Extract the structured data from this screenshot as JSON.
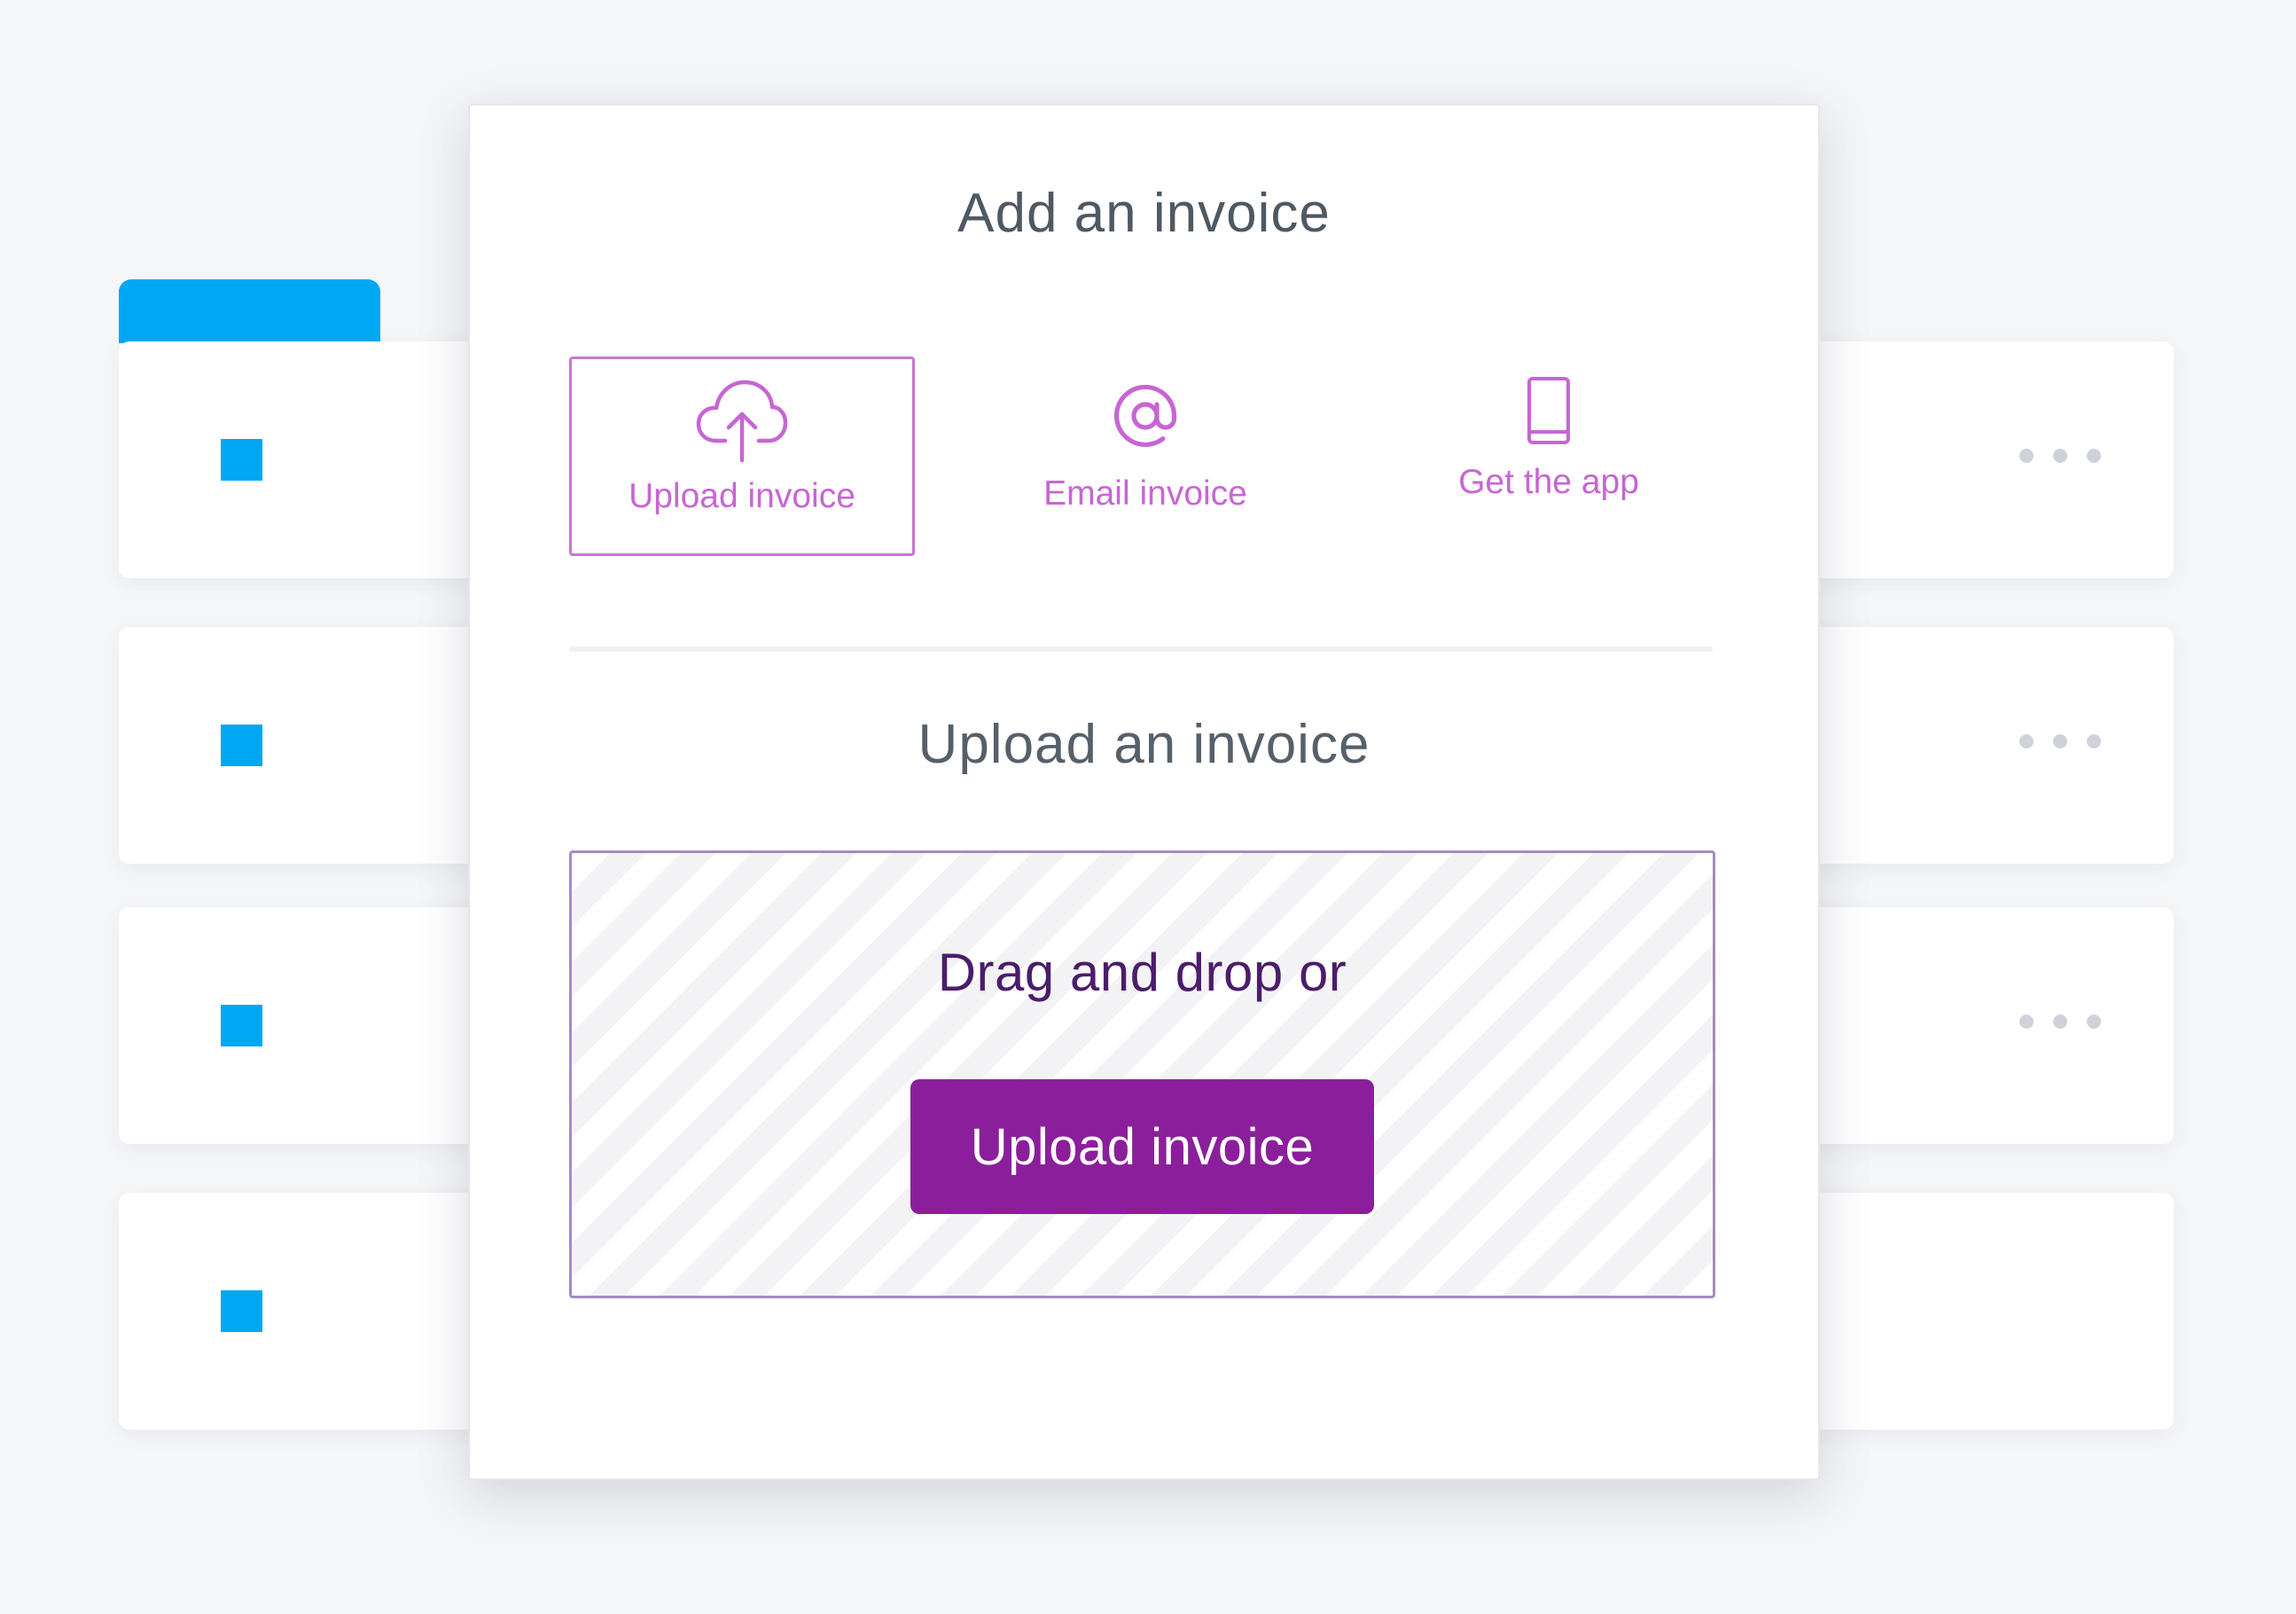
{
  "colors": {
    "accent_blue": "#00a8f4",
    "brand_purple": "#8b1f9b",
    "option_purple": "#c766d3",
    "title_gray": "#4f5963",
    "drop_text": "#4b1d6b"
  },
  "background_list": {
    "rows": [
      {
        "marker": "blue-square",
        "menu_icon": "more-horizontal-icon",
        "has_menu": true
      },
      {
        "marker": "blue-square",
        "menu_icon": "more-horizontal-icon",
        "has_menu": true
      },
      {
        "marker": "blue-square",
        "menu_icon": "more-horizontal-icon",
        "has_menu": true
      },
      {
        "marker": "blue-square",
        "has_menu": false
      }
    ]
  },
  "modal": {
    "title": "Add an invoice",
    "options": [
      {
        "label": "Upload invoice",
        "icon": "cloud-upload-icon",
        "selected": true
      },
      {
        "label": "Email invoice",
        "icon": "at-sign-icon",
        "selected": false
      },
      {
        "label": "Get the app",
        "icon": "smartphone-icon",
        "selected": false
      }
    ],
    "section_title": "Upload an invoice",
    "dropzone": {
      "text": "Drag and drop or",
      "button_label": "Upload invoice"
    }
  }
}
